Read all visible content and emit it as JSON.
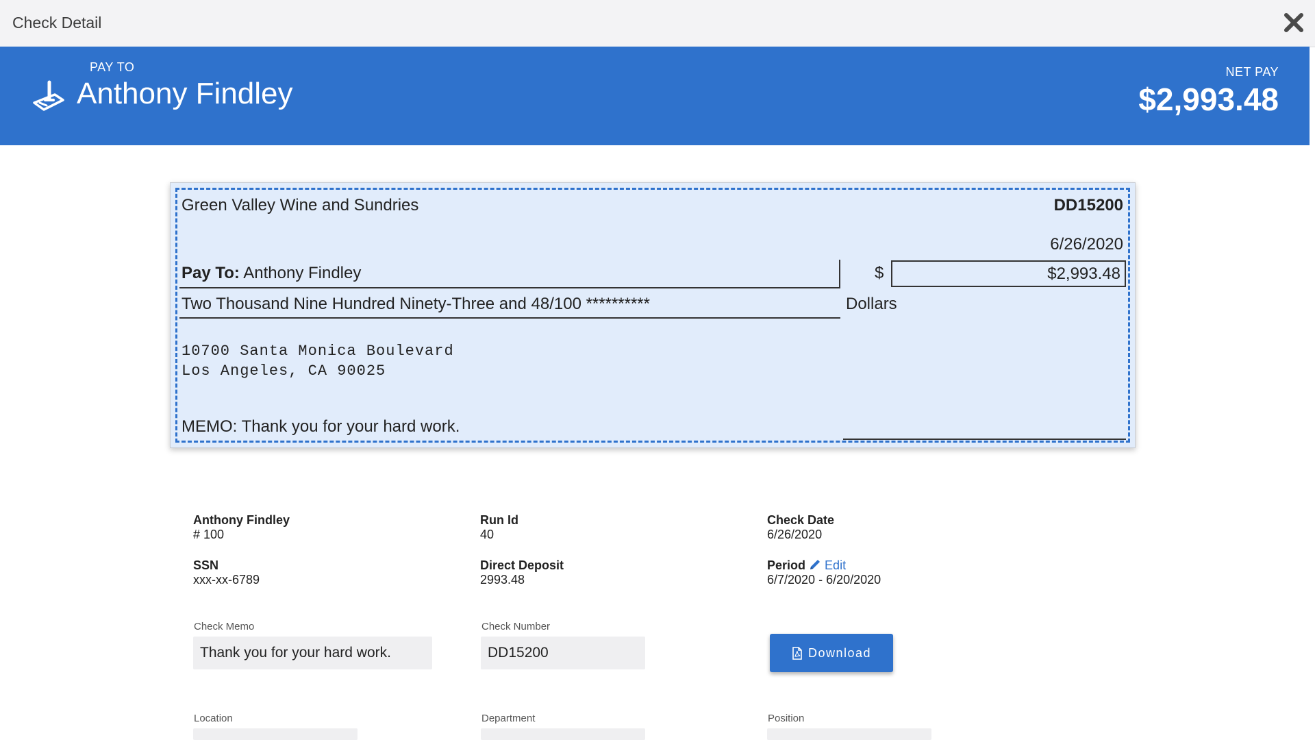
{
  "window": {
    "title": "Check Detail"
  },
  "banner": {
    "pay_to_label": "PAY TO",
    "pay_to_name": "Anthony Findley",
    "net_pay_label": "NET PAY",
    "net_pay_amount": "$2,993.48",
    "icon": "pen-sign-icon",
    "color": "#2f72cc"
  },
  "check": {
    "company": "Green Valley Wine and Sundries",
    "check_number": "DD15200",
    "date": "6/26/2020",
    "pay_to_label": "Pay To:",
    "pay_to_name": "Anthony Findley",
    "dollar_sign": "$",
    "amount": "$2,993.48",
    "amount_words": "Two Thousand Nine Hundred Ninety-Three and 48/100 **********",
    "dollars_label": "Dollars",
    "address_line1": "10700 Santa Monica Boulevard",
    "address_line2": "Los Angeles, CA 90025",
    "memo": "MEMO: Thank you for your hard work."
  },
  "details": {
    "employee_name": "Anthony Findley",
    "employee_number": "# 100",
    "ssn_label": "SSN",
    "ssn_value": "xxx-xx-6789",
    "run_id_label": "Run Id",
    "run_id_value": "40",
    "direct_deposit_label": "Direct Deposit",
    "direct_deposit_value": "2993.48",
    "check_date_label": "Check Date",
    "check_date_value": "6/26/2020",
    "period_label": "Period",
    "edit_label": "Edit",
    "period_value": "6/7/2020 - 6/20/2020"
  },
  "form": {
    "check_memo_label": "Check Memo",
    "check_memo_value": "Thank you for your hard work.",
    "check_number_label": "Check Number",
    "check_number_value": "DD15200",
    "download_label": "Download",
    "location_label": "Location",
    "department_label": "Department",
    "position_label": "Position"
  }
}
